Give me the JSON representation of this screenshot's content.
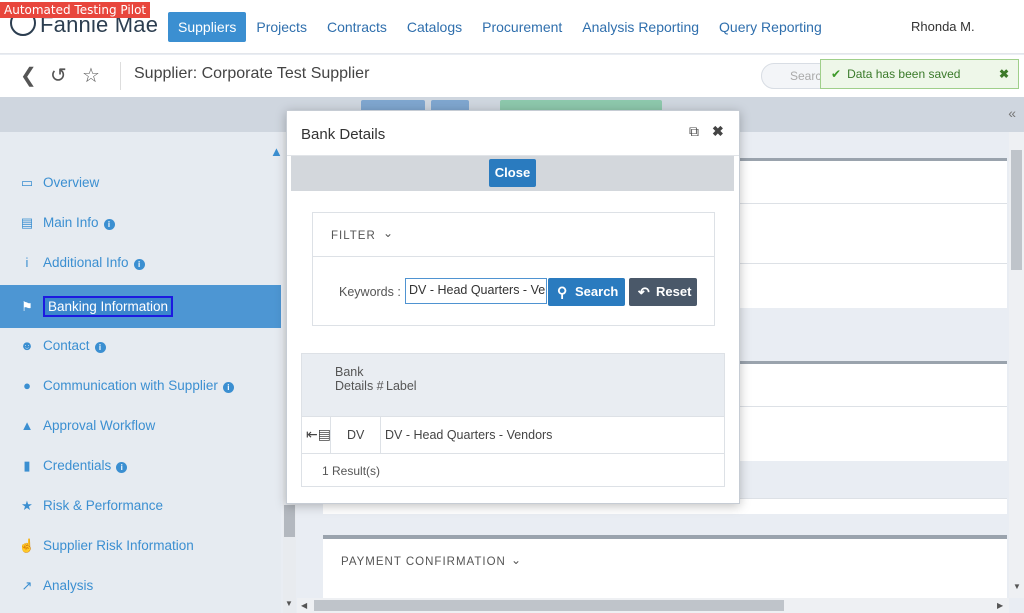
{
  "badge": "Automated Testing Pilot",
  "logo": "Fannie Mae",
  "nav": {
    "items": [
      "Suppliers",
      "Projects",
      "Contracts",
      "Catalogs",
      "Procurement",
      "Analysis Reporting",
      "Query Reporting"
    ],
    "user": "Rhonda M."
  },
  "subbar": {
    "title": "Supplier: Corporate Test Supplier",
    "search_placeholder": "Search"
  },
  "toast": {
    "message": "Data has been saved"
  },
  "sidebar": {
    "items": [
      {
        "label": "Overview",
        "icon": "monitor-icon",
        "info": false
      },
      {
        "label": "Main Info",
        "icon": "id-card-icon",
        "info": true
      },
      {
        "label": "Additional Info",
        "icon": "info-icon",
        "info": true
      },
      {
        "label": "Banking Information",
        "icon": "bank-icon",
        "info": false
      },
      {
        "label": "Contact",
        "icon": "users-icon",
        "info": true
      },
      {
        "label": "Communication with Supplier",
        "icon": "chat-icon",
        "info": true
      },
      {
        "label": "Approval Workflow",
        "icon": "road-icon",
        "info": false
      },
      {
        "label": "Credentials",
        "icon": "book-icon",
        "info": true
      },
      {
        "label": "Risk & Performance",
        "icon": "star-icon",
        "info": false
      },
      {
        "label": "Supplier Risk Information",
        "icon": "thumbs-up-icon",
        "info": false
      },
      {
        "label": "Analysis",
        "icon": "chart-icon",
        "info": false
      }
    ]
  },
  "main": {
    "payment_section": "PAYMENT CONFIRMATION"
  },
  "modal": {
    "title": "Bank Details",
    "close_label": "Close",
    "filter_label": "FILTER",
    "keywords_label": "Keywords :",
    "keywords_value": "DV - Head Quarters - Vendors",
    "search_label": "Search",
    "reset_label": "Reset",
    "columns": [
      "Bank Details #",
      "Label"
    ],
    "rows": [
      {
        "number": "DV",
        "label": "DV - Head Quarters - Vendors"
      }
    ],
    "results": "1 Result(s)"
  },
  "colors": {
    "accent": "#3b8fd1",
    "active_nav": "#3b8fd1",
    "toast_bg": "#eef7e9"
  }
}
